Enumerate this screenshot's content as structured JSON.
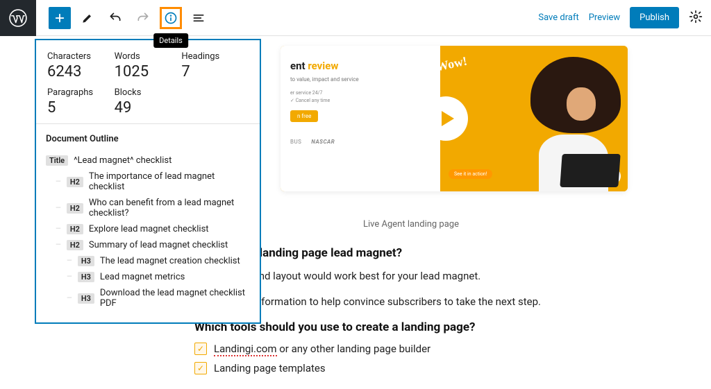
{
  "toolbar": {
    "details_tooltip": "Details",
    "save_draft": "Save draft",
    "preview": "Preview",
    "publish": "Publish"
  },
  "details": {
    "stats": {
      "characters_label": "Characters",
      "characters_value": "6243",
      "words_label": "Words",
      "words_value": "1025",
      "headings_label": "Headings",
      "headings_value": "7",
      "paragraphs_label": "Paragraphs",
      "paragraphs_value": "5",
      "blocks_label": "Blocks",
      "blocks_value": "49"
    },
    "outline_heading": "Document Outline",
    "outline": [
      {
        "level": "Title",
        "text": "^Lead magnet^ checklist",
        "indent": 0
      },
      {
        "level": "H2",
        "text": "The importance of lead magnet checklist",
        "indent": 1
      },
      {
        "level": "H2",
        "text": "Who can benefit from a lead magnet checklist?",
        "indent": 1
      },
      {
        "level": "H2",
        "text": "Explore lead magnet checklist",
        "indent": 1
      },
      {
        "level": "H2",
        "text": "Summary of lead magnet checklist",
        "indent": 1
      },
      {
        "level": "H3",
        "text": "The lead magnet creation checklist",
        "indent": 2
      },
      {
        "level": "H3",
        "text": "Lead magnet metrics",
        "indent": 2
      },
      {
        "level": "H3",
        "text": "Download the lead magnet checklist PDF",
        "indent": 2
      }
    ]
  },
  "hero": {
    "title_a": "ent ",
    "title_b": "review",
    "subtitle": "to value, impact and service",
    "line1": "er service 24/7",
    "line2": "✓ Cancel any time",
    "try_label": "n free",
    "wow": "Wow!",
    "see_action": "See it in action!",
    "brand1": "BUS",
    "brand2": "NASCAR"
  },
  "caption": "Live Agent landing page",
  "article": {
    "h3a": "e creating a landing page lead magnet?",
    "p1a": "what design and layout would work best for your lead magnet.",
    "p1b": " and concise information to help convince subscribers to take the next step.",
    "h3b": "Which tools should you use to create a landing page?",
    "li1a": "Landingi.com",
    "li1b": " or any other landing page builder",
    "li2": "Landing page templates"
  }
}
